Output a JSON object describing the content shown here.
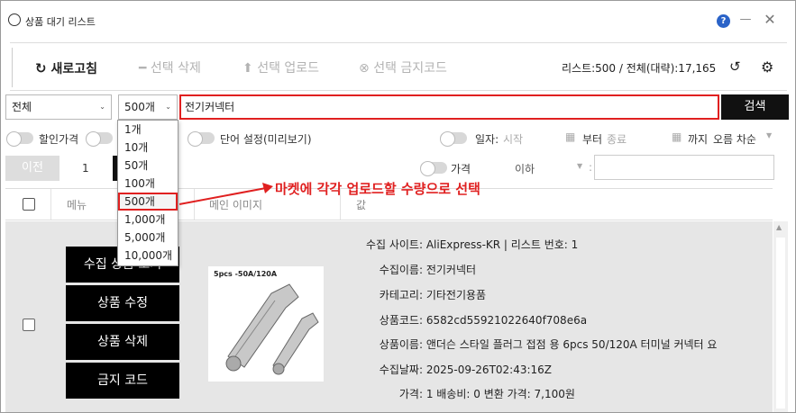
{
  "window": {
    "title": "상품 대기 리스트",
    "help": "?",
    "minimize": "—",
    "close": "✕"
  },
  "toolbar": {
    "refresh_label": "새로고침",
    "delete_label": "선택 삭제",
    "upload_label": "선택 업로드",
    "ban_label": "선택 금지코드",
    "counts_text": "리스트:500  /  전체(대략):17,165"
  },
  "filters": {
    "category_value": "전체",
    "count_value": "500개",
    "search_value": "전기커넥터",
    "search_button": "검색",
    "discount_label": "할인가격",
    "word_setting_label": "단어 설정(미리보기)",
    "date_label": "일자:",
    "start_placeholder": "시작",
    "from_label": "부터",
    "end_placeholder": "종료",
    "until_label": "까지",
    "sort_value": "오름 차순",
    "price_label": "가격",
    "below_value": "이하",
    "colon": ":"
  },
  "dropdown": {
    "options": [
      "1개",
      "10개",
      "50개",
      "100개",
      "500개",
      "1,000개",
      "5,000개",
      "10,000개"
    ]
  },
  "pager": {
    "prev": "이전",
    "page": "1"
  },
  "table": {
    "col_menu": "메뉴",
    "col_image": "메인 이미지",
    "col_value": "값"
  },
  "row": {
    "buttons": [
      "수집 상품 보기",
      "상품 수정",
      "상품 삭제",
      "금지 코드"
    ],
    "image_caption": "5pcs -50A/120A",
    "info": [
      {
        "k": "수집 사이트:",
        "v": "AliExpress-KR | 리스트 번호: 1"
      },
      {
        "k": "수집이름:",
        "v": "전기커넥터"
      },
      {
        "k": "카테고리:",
        "v": "기타전기용품"
      },
      {
        "k": "상품코드:",
        "v": "6582cd55921022640f708e6a"
      },
      {
        "k": "상품이름:",
        "v": "앤더슨 스타일 플러그 접점 용 6pcs 50/120A 터미널 커넥터 요"
      },
      {
        "k": "수집날짜:",
        "v": "2025-09-26T02:43:16Z"
      },
      {
        "k": "가격:",
        "v": "1  배송비: 0  변환 가격: 7,100원"
      }
    ]
  },
  "annotation": "마켓에 각각 업로드할 수량으로 선택",
  "colors": {
    "accent_red": "#e02020",
    "button_black": "#111111",
    "help_blue": "#2a63c8"
  }
}
